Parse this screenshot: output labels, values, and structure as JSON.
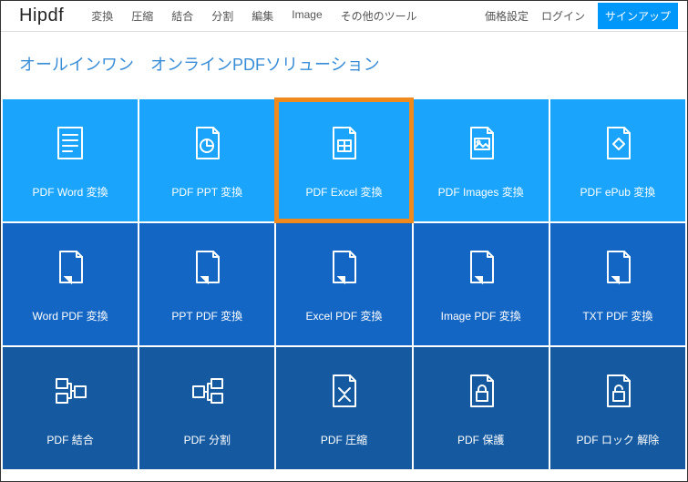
{
  "brand": "Hipdf",
  "nav": [
    "変換",
    "圧縮",
    "結合",
    "分割",
    "編集",
    "Image",
    "その他のツール"
  ],
  "rightNav": {
    "pricing": "価格設定",
    "login": "ログイン",
    "signup": "サインアップ"
  },
  "headline": "オールインワン　オンラインPDFソリューション",
  "tiles": [
    {
      "label": "PDF Word 変換",
      "icon": "doc-lines",
      "row": 0,
      "name": "tile-pdf-word",
      "highlight": false
    },
    {
      "label": "PDF PPT 変換",
      "icon": "doc-pie",
      "row": 0,
      "name": "tile-pdf-ppt",
      "highlight": false
    },
    {
      "label": "PDF Excel 変換",
      "icon": "doc-grid",
      "row": 0,
      "name": "tile-pdf-excel",
      "highlight": true
    },
    {
      "label": "PDF Images 変換",
      "icon": "doc-image",
      "row": 0,
      "name": "tile-pdf-images",
      "highlight": false
    },
    {
      "label": "PDF ePub 変換",
      "icon": "doc-diamond",
      "row": 0,
      "name": "tile-pdf-epub",
      "highlight": false
    },
    {
      "label": "Word PDF 変換",
      "icon": "doc-fold",
      "row": 1,
      "name": "tile-word-pdf",
      "highlight": false
    },
    {
      "label": "PPT PDF 変換",
      "icon": "doc-fold",
      "row": 1,
      "name": "tile-ppt-pdf",
      "highlight": false
    },
    {
      "label": "Excel PDF 変換",
      "icon": "doc-fold",
      "row": 1,
      "name": "tile-excel-pdf",
      "highlight": false
    },
    {
      "label": "Image PDF 変換",
      "icon": "doc-fold",
      "row": 1,
      "name": "tile-image-pdf",
      "highlight": false
    },
    {
      "label": "TXT PDF 変換",
      "icon": "doc-fold",
      "row": 1,
      "name": "tile-txt-pdf",
      "highlight": false
    },
    {
      "label": "PDF 結合",
      "icon": "merge",
      "row": 2,
      "name": "tile-merge",
      "highlight": false
    },
    {
      "label": "PDF 分割",
      "icon": "split",
      "row": 2,
      "name": "tile-split",
      "highlight": false
    },
    {
      "label": "PDF 圧縮",
      "icon": "compress",
      "row": 2,
      "name": "tile-compress",
      "highlight": false
    },
    {
      "label": "PDF 保護",
      "icon": "lock",
      "row": 2,
      "name": "tile-protect",
      "highlight": false
    },
    {
      "label": "PDF ロック 解除",
      "icon": "unlock",
      "row": 2,
      "name": "tile-unlock",
      "highlight": false
    }
  ]
}
